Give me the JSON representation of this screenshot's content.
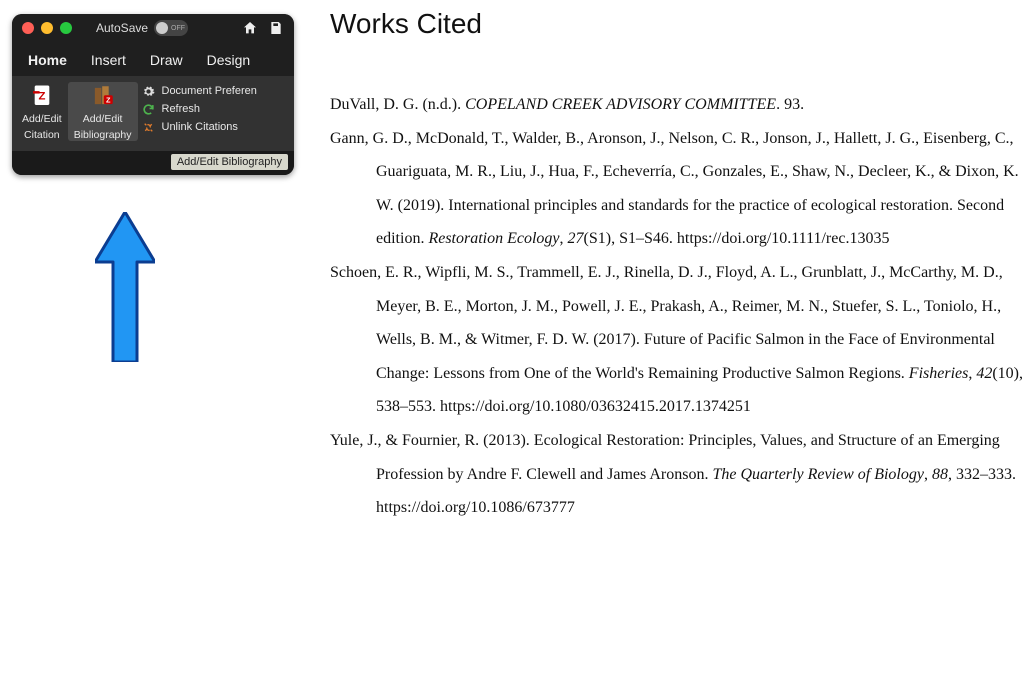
{
  "toolbar": {
    "autosave_label": "AutoSave",
    "autosave_state": "OFF",
    "tabs": [
      "Home",
      "Insert",
      "Draw",
      "Design"
    ],
    "groups": {
      "citation": {
        "label_l1": "Add/Edit",
        "label_l2": "Citation"
      },
      "bibliography": {
        "label_l1": "Add/Edit",
        "label_l2": "Bibliography"
      }
    },
    "side_items": {
      "prefs": "Document Preferen",
      "refresh": "Refresh",
      "unlink": "Unlink Citations"
    },
    "tooltip": "Add/Edit Bibliography"
  },
  "doc": {
    "heading": "Works Cited",
    "e1": {
      "a": "DuVall, D. G. (n.d.). ",
      "b": "COPELAND CREEK ADVISORY COMMITTEE",
      "c": ". 93."
    },
    "e2": {
      "a": "Gann, G. D., McDonald, T., Walder, B., Aronson, J., Nelson, C. R., Jonson, J., Hallett, J. G., Eisenberg, C., Guariguata, M. R., Liu, J., Hua, F., Echeverría, C., Gonzales, E., Shaw, N., Decleer, K., & Dixon, K. W. (2019). International principles and standards for the practice of ecological restoration. Second edition. ",
      "b": "Restoration Ecology",
      "c": ", ",
      "d": "27",
      "e": "(S1), S1–S46. https://doi.org/10.1111/rec.13035"
    },
    "e3": {
      "a": "Schoen, E. R., Wipfli, M. S., Trammell, E. J., Rinella, D. J., Floyd, A. L., Grunblatt, J., McCarthy, M. D., Meyer, B. E., Morton, J. M., Powell, J. E., Prakash, A., Reimer, M. N., Stuefer, S. L., Toniolo, H., Wells, B. M., & Witmer, F. D. W. (2017). Future of Pacific Salmon in the Face of Environmental Change: Lessons from One of the World's Remaining Productive Salmon Regions. ",
      "b": "Fisheries",
      "c": ", ",
      "d": "42",
      "e": "(10), 538–553. https://doi.org/10.1080/03632415.2017.1374251"
    },
    "e4": {
      "a": "Yule, J., & Fournier, R. (2013). Ecological Restoration: Principles, Values, and Structure of an Emerging Profession by Andre F. Clewell and James Aronson. ",
      "b": "The Quarterly Review of Biology",
      "c": ", ",
      "d": "88",
      "e": ", 332–333. https://doi.org/10.1086/673777"
    }
  }
}
